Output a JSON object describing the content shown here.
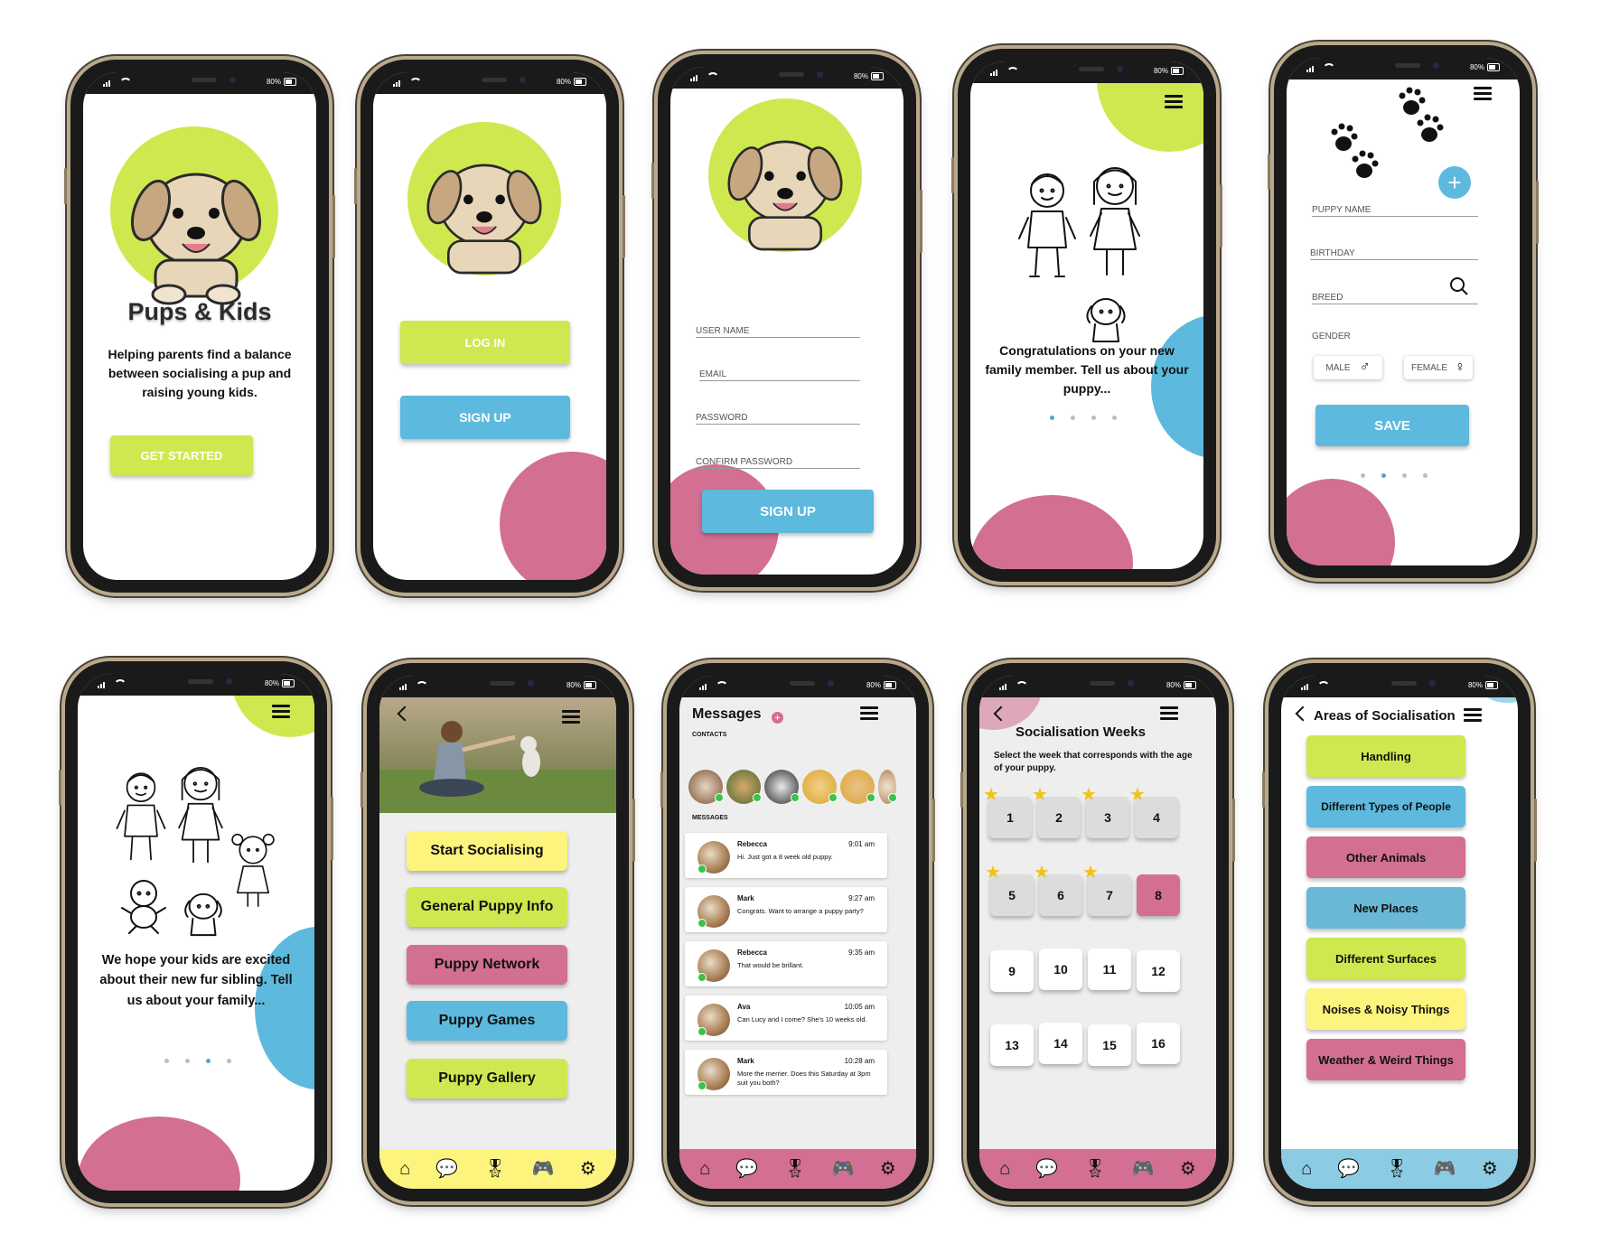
{
  "colors": {
    "lime": "#cfe84f",
    "blue": "#5db9dd",
    "pink": "#d26f93",
    "yellow": "#fdf47d",
    "grey": "#eeeeee"
  },
  "status": {
    "battery": "80%"
  },
  "welcome": {
    "title": "Pups & Kids",
    "tagline": "Helping parents find a balance between socialising a pup and raising young kids.",
    "cta": "GET STARTED"
  },
  "auth": {
    "login": "LOG IN",
    "signup": "SIGN UP"
  },
  "register": {
    "fields": [
      "USER NAME",
      "EMAIL",
      "PASSWORD",
      "CONFIRM PASSWORD"
    ],
    "submit": "SIGN UP"
  },
  "intro1": {
    "text": "Congratulations on your new family member. Tell us about your puppy..."
  },
  "puppy_form": {
    "fields": {
      "name": "PUPPY NAME",
      "birthday": "BIRTHDAY",
      "breed": "BREED",
      "gender": "GENDER"
    },
    "male": "MALE",
    "female": "FEMALE",
    "save": "SAVE"
  },
  "intro2": {
    "text": "We hope your kids are excited about their new fur sibling. Tell us about your family..."
  },
  "home_menu": {
    "items": [
      "Start Socialising",
      "General Puppy Info",
      "Puppy Network",
      "Puppy Games",
      "Puppy Gallery"
    ]
  },
  "messages": {
    "title": "Messages",
    "contacts_label": "CONTACTS",
    "messages_label": "MESSAGES",
    "items": [
      {
        "name": "Rebecca",
        "time": "9:01 am",
        "text": "Hi. Just got a  8 week old puppy."
      },
      {
        "name": "Mark",
        "time": "9:27 am",
        "text": "Congrats. Want to arrange a puppy party?"
      },
      {
        "name": "Rebecca",
        "time": "9:35 am",
        "text": "That would be brillant."
      },
      {
        "name": "Ava",
        "time": "10:05 am",
        "text": "Can Lucy and I come? She's 10 weeks old."
      },
      {
        "name": "Mark",
        "time": "10:28 am",
        "text": "More the merrier. Does this Saturday at 3pm suit you both?"
      }
    ]
  },
  "weeks": {
    "title": "Socialisation Weeks",
    "subtitle": "Select the week that corresponds with the age of your puppy.",
    "numbers": [
      "1",
      "2",
      "3",
      "4",
      "5",
      "6",
      "7",
      "8",
      "9",
      "10",
      "11",
      "12",
      "13",
      "14",
      "15",
      "16"
    ],
    "starred": [
      "1",
      "2",
      "3",
      "4",
      "5",
      "6",
      "7"
    ],
    "selected": "8"
  },
  "areas": {
    "title": "Areas of Socialisation",
    "items": [
      "Handling",
      "Different Types of People",
      "Other Animals",
      "New Places",
      "Different Surfaces",
      "Noises & Noisy Things",
      "Weather & Weird Things"
    ]
  },
  "icons": {
    "nav": [
      "home-icon",
      "chat-icon",
      "badge-icon",
      "gamepad-icon",
      "gear-icon"
    ]
  }
}
